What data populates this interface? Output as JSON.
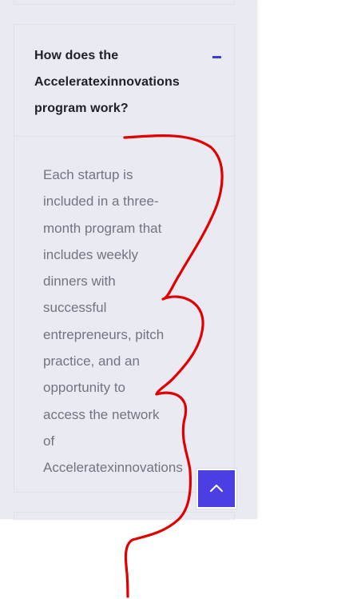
{
  "faq": {
    "question": "How does the\nAcceleratexinnovations\nprogram work?",
    "answer": "Each startup is\nincluded in a three-\nmonth program that\nincludes weekly\ndinners with\nsuccessful\nentrepreneurs, pitch\npractice, and an\nopportunity to\naccess the network\nof\nAcceleratexinnovations",
    "collapse_icon": "minus-icon"
  },
  "scroll_top": {
    "icon": "chevron-up-icon"
  },
  "annotation": {
    "color": "#e00000"
  },
  "colors": {
    "panel_background": "#eaebf2",
    "accent": "#4b3fe3",
    "question_text": "#1f1f2a",
    "answer_text": "#727381"
  }
}
